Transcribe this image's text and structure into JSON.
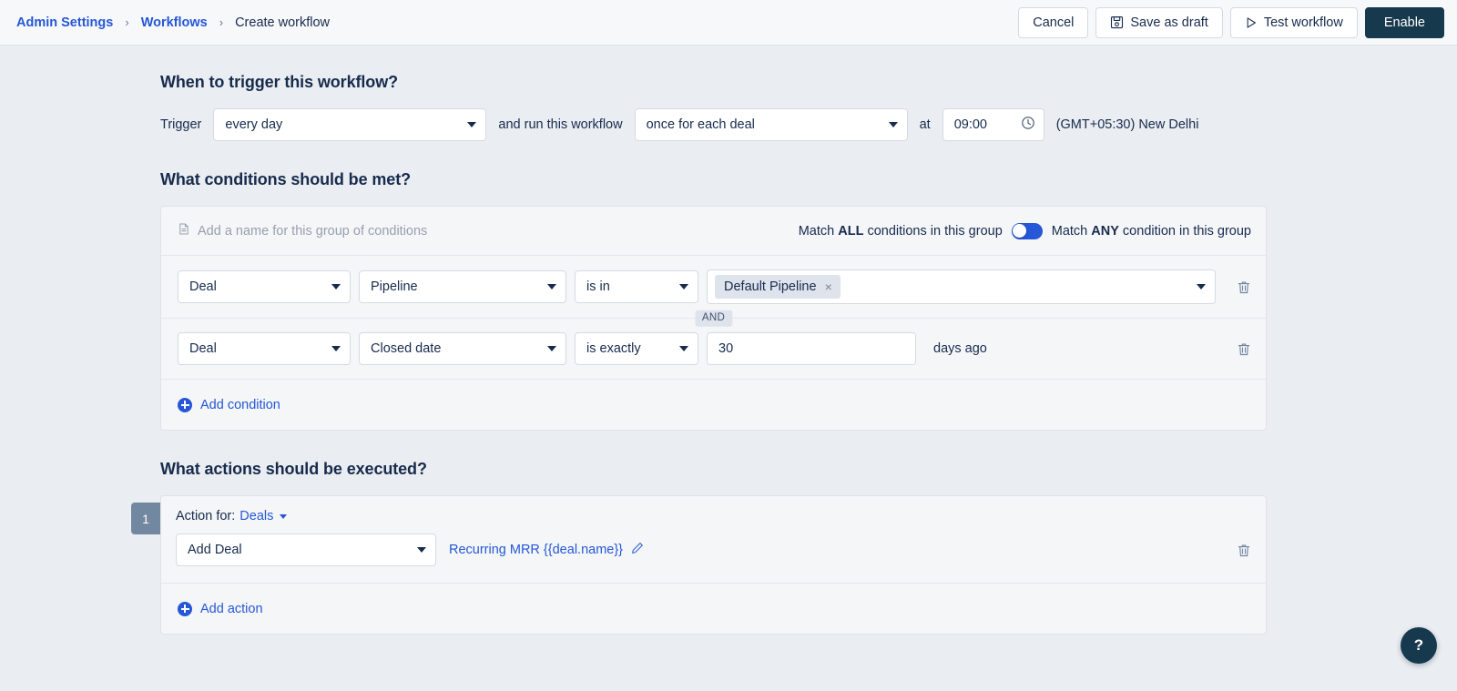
{
  "topbar": {
    "breadcrumb": {
      "admin_settings": "Admin Settings",
      "workflows": "Workflows",
      "separator": "›",
      "current": "Create workflow"
    },
    "buttons": {
      "cancel": "Cancel",
      "save_draft": "Save as draft",
      "test_workflow": "Test workflow",
      "enable": "Enable"
    },
    "icons": {
      "save": "floppy-disk-icon",
      "test": "play-icon"
    }
  },
  "trigger_section": {
    "title": "When to trigger this workflow?",
    "label_trigger": "Trigger",
    "trigger_value": "every day",
    "label_and_run": "and run this workflow",
    "run_mode_value": "once for each deal",
    "label_at": "at",
    "time_value": "09:00",
    "clock_icon": "clock-icon",
    "timezone": "(GMT+05:30) New Delhi"
  },
  "conditions_section": {
    "title": "What conditions should be met?",
    "group_name_placeholder": "Add a name for this group of conditions",
    "group_name_icon": "document-icon",
    "match_all_prefix": "Match ",
    "match_all_strong": "ALL",
    "match_all_suffix": " conditions in this group",
    "match_any_prefix": "Match ",
    "match_any_strong": "ANY",
    "match_any_suffix": " condition in this group",
    "toggle_state": "off",
    "joiner": "AND",
    "add_condition": "Add condition",
    "rows": [
      {
        "entity": "Deal",
        "property": "Pipeline",
        "operator": "is in",
        "value_type": "chips",
        "chips": [
          {
            "label": "Default Pipeline",
            "remove": "×"
          }
        ],
        "suffix": ""
      },
      {
        "entity": "Deal",
        "property": "Closed date",
        "operator": "is exactly",
        "value_type": "text",
        "value": "30",
        "suffix": "days ago"
      }
    ]
  },
  "actions_section": {
    "title": "What actions should be executed?",
    "add_action": "Add action",
    "steps": [
      {
        "number": "1",
        "action_for_label": "Action for:",
        "action_for_object": "Deals",
        "action_value": "Add Deal",
        "template_name": "Recurring MRR {{deal.name}}",
        "edit_icon": "pencil-icon",
        "delete_icon": "trash-icon"
      }
    ]
  },
  "help": {
    "label": "?"
  },
  "colors": {
    "accent_blue": "#2557d6",
    "dark_navy": "#17394d",
    "page_bg": "#eaedf1",
    "card_bg": "#f5f6f8",
    "step_badge": "#7287a0"
  }
}
